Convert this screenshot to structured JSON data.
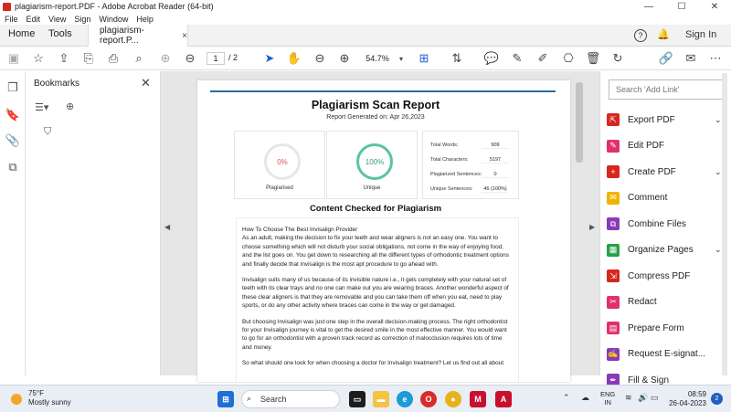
{
  "window": {
    "title": "plagiarism-report.PDF - Adobe Acrobat Reader (64-bit)",
    "minimize": "—",
    "maximize": "☐",
    "close": "✕"
  },
  "menu": [
    "File",
    "Edit",
    "View",
    "Sign",
    "Window",
    "Help"
  ],
  "tabs": {
    "home": "Home",
    "tools": "Tools",
    "document": "plagiarism-report.P...",
    "doc_close": "×",
    "help": "?",
    "signin": "Sign In"
  },
  "toolbar": {
    "page_current": "1",
    "page_total": "/ 2",
    "zoom": "54.7%"
  },
  "bookmarks": {
    "title": "Bookmarks",
    "close": "✕"
  },
  "report": {
    "title": "Plagiarism Scan Report",
    "date": "Report Generated on: Apr 26,2023",
    "plagiarised_value": "0%",
    "plagiarised_label": "Plagiarised",
    "unique_value": "100%",
    "unique_label": "Unique",
    "stats": [
      {
        "label": "Total Words:",
        "value": "909"
      },
      {
        "label": "Total Characters:",
        "value": "5197"
      },
      {
        "label": "Plagiarized Sentences:",
        "value": "0"
      },
      {
        "label": "Unique Sentences:",
        "value": "46 (100%)"
      }
    ],
    "content_title": "Content Checked for Plagiarism",
    "paragraphs": [
      "How To Choose The Best Invisalign Provider",
      "As an adult, making the decision to fix your teeth and wear aligners is not an easy one. You want to choose something which will not disturb your social obligations, not come in the way of enjoying food, and the list goes on. You get down to researching all the different types of orthodontic treatment options and finally decide that Invisalign is the most apt procedure to go ahead with.",
      "Invisalign suits many of us because of its invisible nature i.e., it gels completely with your natural set of teeth with its clear trays and no one can make out you are wearing braces. Another wonderful aspect of these clear aligners is that they are removable and you can take them off when you eat, need to play sports, or do any other activity where braces can come in the way or get damaged.",
      "But choosing Invisalign was just one step in the overall decision-making process. The right orthodontist for your Invisalign journey is vital to get the desired smile in the most effective manner. You would want to go for an orthodontist with a proven track record as correction of malocclusion requires lots of time and money.",
      "So what should one look for when choosing a doctor for Invisalign treatment? Let us find out all about"
    ]
  },
  "right_pane": {
    "search_placeholder": "Search 'Add Link'",
    "tools": [
      {
        "label": "Export PDF",
        "color": "#d7261e",
        "icon": "export-pdf-icon",
        "chevron": "⌄"
      },
      {
        "label": "Edit PDF",
        "color": "#e1306c",
        "icon": "edit-pdf-icon",
        "chevron": ""
      },
      {
        "label": "Create PDF",
        "color": "#d7261e",
        "icon": "create-pdf-icon",
        "chevron": "⌄"
      },
      {
        "label": "Comment",
        "color": "#f0b400",
        "icon": "comment-icon",
        "chevron": ""
      },
      {
        "label": "Combine Files",
        "color": "#8a3ab9",
        "icon": "combine-files-icon",
        "chevron": ""
      },
      {
        "label": "Organize Pages",
        "color": "#27a04a",
        "icon": "organize-pages-icon",
        "chevron": "⌄"
      },
      {
        "label": "Compress PDF",
        "color": "#d7261e",
        "icon": "compress-pdf-icon",
        "chevron": ""
      },
      {
        "label": "Redact",
        "color": "#e1306c",
        "icon": "redact-icon",
        "chevron": ""
      },
      {
        "label": "Prepare Form",
        "color": "#e1306c",
        "icon": "prepare-form-icon",
        "chevron": ""
      },
      {
        "label": "Request E-signat...",
        "color": "#8a3ab9",
        "icon": "request-esign-icon",
        "chevron": ""
      },
      {
        "label": "Fill & Sign",
        "color": "#8a3ab9",
        "icon": "fill-sign-icon",
        "chevron": ""
      }
    ]
  },
  "taskbar": {
    "temp": "75°F",
    "weather": "Mostly sunny",
    "search": "Search",
    "lang1": "ENG",
    "lang2": "IN",
    "time": "08:59",
    "date": "26-04-2023",
    "notifications": "2"
  }
}
